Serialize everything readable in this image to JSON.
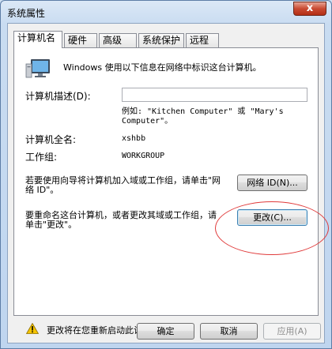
{
  "window": {
    "title": "系统属性",
    "close_glyph": "x"
  },
  "tabs": [
    {
      "label": "计算机名",
      "active": true
    },
    {
      "label": "硬件",
      "active": false
    },
    {
      "label": "高级",
      "active": false
    },
    {
      "label": "系统保护",
      "active": false
    },
    {
      "label": "远程",
      "active": false
    }
  ],
  "intro": "Windows 使用以下信息在网络中标识这台计算机。",
  "description": {
    "label": "计算机描述(D):",
    "value": "",
    "example": "例如: \"Kitchen Computer\" 或 \"Mary's Computer\"。"
  },
  "full_name": {
    "label": "计算机全名:",
    "value": "xshbb"
  },
  "workgroup": {
    "label": "工作组:",
    "value": "WORKGROUP"
  },
  "network_id": {
    "text": "若要使用向导将计算机加入域或工作组，请单击\"网络 ID\"。",
    "button": "网络 ID(N)..."
  },
  "rename": {
    "text": "要重命名这台计算机，或者更改其域或工作组，请单击\"更改\"。",
    "button": "更改(C)..."
  },
  "warning": "更改将在您重新启动此计算机后生效。",
  "buttons": {
    "ok": "确定",
    "cancel": "取消",
    "apply": "应用(A)"
  },
  "colors": {
    "highlight_ellipse": "#e03a3a",
    "title_bar": "#c9dcf1"
  }
}
